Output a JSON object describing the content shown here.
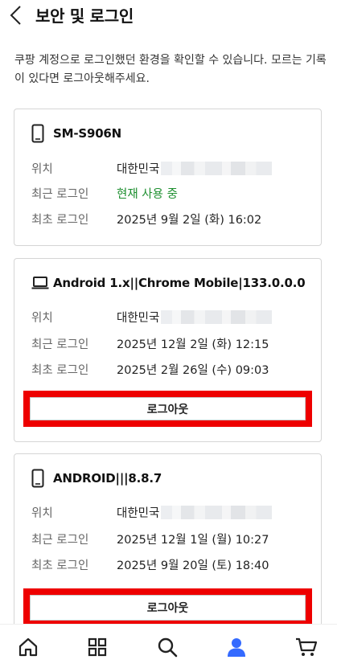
{
  "header": {
    "title": "보안 및 로그인",
    "back_icon": "chevron-left-icon"
  },
  "intro": "쿠팡 계정으로 로그인했던 환경을 확인할 수 있습니다. 모르는 기록이 있다면 로그아웃해주세요.",
  "devices": [
    {
      "icon": "smartphone-icon",
      "name": "SM-S906N",
      "location_label": "위치",
      "location_value": "대한민국",
      "recent_label": "최근 로그인",
      "recent_value": "현재 사용 중",
      "recent_color": "#1d8f2f",
      "first_label": "최초 로그인",
      "first_value": "2025년 9월 2일 (화) 16:02"
    },
    {
      "icon": "laptop-icon",
      "name": "Android 1.x||Chrome Mobile|133.0.0.0",
      "location_label": "위치",
      "location_value": "대한민국",
      "recent_label": "최근 로그인",
      "recent_value": "2025년 12월 2일 (화) 12:15",
      "first_label": "최초 로그인",
      "first_value": "2025년 2월 26일 (수) 09:03",
      "logout_label": "로그아웃"
    },
    {
      "icon": "smartphone-icon",
      "name": "ANDROID|||8.8.7",
      "location_label": "위치",
      "location_value": "대한민국",
      "recent_label": "최근 로그인",
      "recent_value": "2025년 12월 1일 (월) 10:27",
      "first_label": "최초 로그인",
      "first_value": "2025년 9월 20일 (토) 18:40",
      "logout_label": "로그아웃"
    }
  ],
  "tabbar": [
    {
      "icon": "home-icon"
    },
    {
      "icon": "categories-grid-icon"
    },
    {
      "icon": "search-icon"
    },
    {
      "icon": "my-account-icon",
      "active": true,
      "active_color": "#346aff"
    },
    {
      "icon": "cart-icon"
    }
  ],
  "colors": {
    "highlight_border": "#ee0000",
    "green_status": "#1d8f2f",
    "active_tab": "#346aff"
  }
}
